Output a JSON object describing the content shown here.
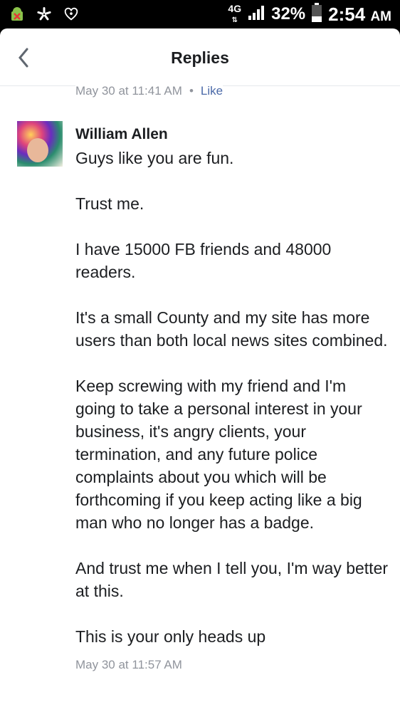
{
  "status_bar": {
    "network": "4G",
    "battery": "32%",
    "time": "2:54",
    "ampm": "AM",
    "icons": [
      "android-debug-icon",
      "yelp-icon",
      "iheartradio-icon"
    ]
  },
  "header": {
    "title": "Replies"
  },
  "previous_comment": {
    "timestamp": "May 30 at 11:41 AM",
    "separator": "•",
    "like_label": "Like"
  },
  "comment": {
    "author": "William Allen",
    "paragraphs": [
      "Guys like you are fun.",
      "Trust me.",
      "I have 15000 FB friends and 48000 readers.",
      "It's a small County and my site has more users than both local news sites combined.",
      "Keep screwing with my friend and I'm going to take a personal interest in your business, it's angry clients, your termination, and any future police complaints about you which will be forthcoming if you keep acting like a big man who no longer has a badge.",
      "And trust me when I tell you, I'm way better at this.",
      "This is your only heads up"
    ],
    "timestamp": "May 30 at 11:57 AM"
  }
}
